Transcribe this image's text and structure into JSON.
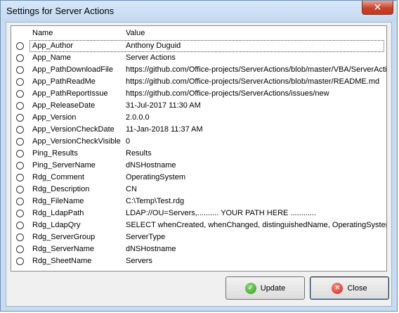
{
  "window": {
    "title": "Settings for Server Actions",
    "close_glyph": "✕"
  },
  "list": {
    "columns": {
      "name": "Name",
      "value": "Value"
    },
    "rows": [
      {
        "name": "App_Author",
        "value": "Anthony Duguid"
      },
      {
        "name": "App_Name",
        "value": "Server Actions"
      },
      {
        "name": "App_PathDownloadFile",
        "value": "https://github.com/Office-projects/ServerActions/blob/master/VBA/ServerActio"
      },
      {
        "name": "App_PathReadMe",
        "value": "https://github.com/Office-projects/ServerActions/blob/master/README.md"
      },
      {
        "name": "App_PathReportIssue",
        "value": "https://github.com/Office-projects/ServerActions/issues/new"
      },
      {
        "name": "App_ReleaseDate",
        "value": "31-Jul-2017 11:30 AM"
      },
      {
        "name": "App_Version",
        "value": "2.0.0.0"
      },
      {
        "name": "App_VersionCheckDate",
        "value": "11-Jan-2018 11:37 AM"
      },
      {
        "name": "App_VersionCheckVisible",
        "value": "0"
      },
      {
        "name": "Ping_Results",
        "value": "Results"
      },
      {
        "name": "Ping_ServerName",
        "value": "dNSHostname"
      },
      {
        "name": "Rdg_Comment",
        "value": "OperatingSystem"
      },
      {
        "name": "Rdg_Description",
        "value": "CN"
      },
      {
        "name": "Rdg_FileName",
        "value": "C:\\Temp\\Test.rdg"
      },
      {
        "name": "Rdg_LdapPath",
        "value": "LDAP://OU=Servers,.......... YOUR PATH HERE ............"
      },
      {
        "name": "Rdg_LdapQry",
        "value": "SELECT whenCreated, whenChanged, distinguishedName, OperatingSystem, C"
      },
      {
        "name": "Rdg_ServerGroup",
        "value": "ServerType"
      },
      {
        "name": "Rdg_ServerName",
        "value": "dNSHostname"
      },
      {
        "name": "Rdg_SheetName",
        "value": "Servers"
      }
    ]
  },
  "buttons": {
    "update": "Update",
    "close": "Close"
  }
}
